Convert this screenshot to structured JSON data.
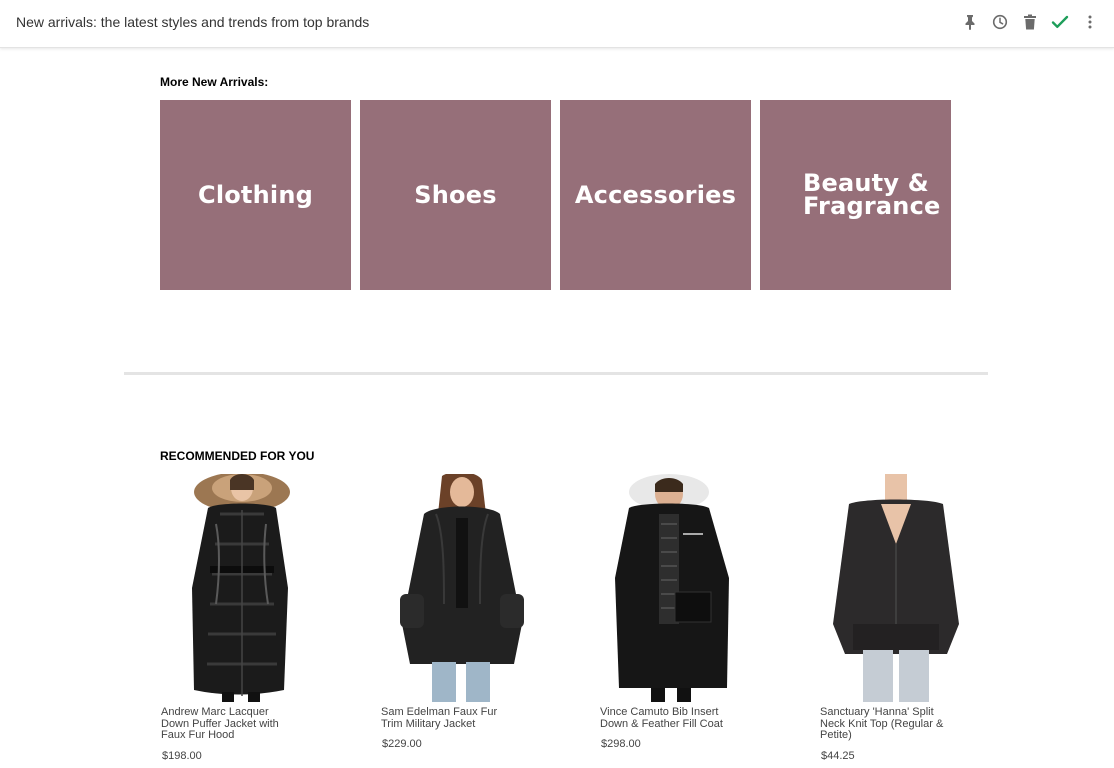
{
  "header": {
    "subject": "New arrivals: the latest styles and trends from top brands",
    "actions": [
      {
        "icon": "pin-icon"
      },
      {
        "icon": "clock-icon"
      },
      {
        "icon": "trash-icon"
      },
      {
        "icon": "check-icon",
        "color": "#1e9e5a"
      },
      {
        "icon": "more-vertical-icon"
      }
    ]
  },
  "arrivals": {
    "label": "More New Arrivals:",
    "tile_color": "#966f79",
    "tiles": [
      {
        "label": "Clothing"
      },
      {
        "label": "Shoes"
      },
      {
        "label": "Accessories"
      },
      {
        "label": "Beauty & Fragrance"
      }
    ]
  },
  "recommended": {
    "label": "RECOMMENDED FOR YOU",
    "products": [
      {
        "name": "Andrew Marc Lacquer Down Puffer Jacket with Faux Fur Hood",
        "price": "$198.00"
      },
      {
        "name": "Sam Edelman Faux Fur Trim Military Jacket",
        "price": "$229.00"
      },
      {
        "name": "Vince Camuto Bib Insert Down & Feather Fill Coat",
        "price": "$298.00"
      },
      {
        "name": "Sanctuary 'Hanna' Split Neck Knit Top (Regular & Petite)",
        "price": "$44.25"
      }
    ]
  }
}
